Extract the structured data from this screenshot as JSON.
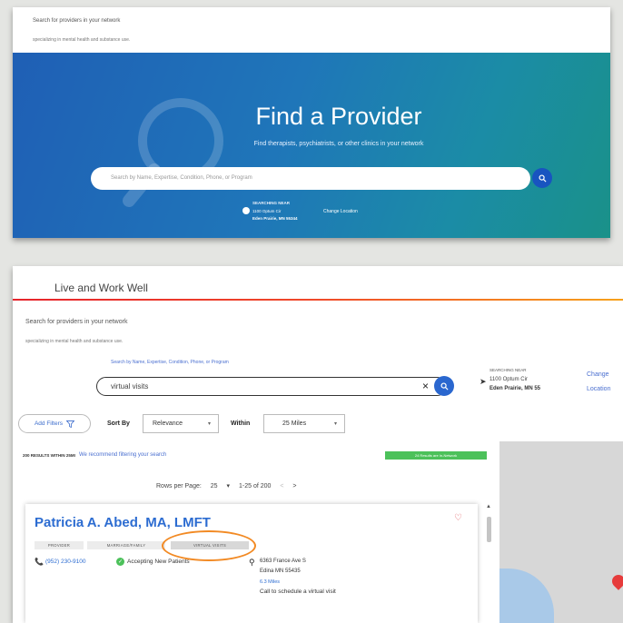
{
  "top": {
    "intro_line1": "Search for providers in your network",
    "intro_line2": "specializing in mental health and substance use.",
    "title": "Find a Provider",
    "subtitle": "Find therapists, psychiatrists, or other clinics in your network",
    "search_placeholder": "Search by Name, Expertise, Condition, Phone, or Program",
    "near_label": "SEARCHING NEAR",
    "address_line1": "1100 Optum Cir",
    "address_line2": "Eden Prairie, MN 55344",
    "change_location": "Change Location",
    "hero_colors": [
      "#1f5fb5",
      "#1a9189"
    ]
  },
  "bottom": {
    "brand": "Live and Work Well",
    "intro_line1": "Search for providers in your network",
    "intro_line2": "specializing in mental health and substance use.",
    "search_hint": "Search by Name, Expertise, Condition, Phone, or Program",
    "search_value": "virtual visits",
    "near_label": "SEARCHING NEAR",
    "address_line1": "1100 Optum Cir",
    "address_line2": "Eden Prairie, MN 55",
    "change_line1": "Change",
    "change_line2": "Location",
    "filters_label": "Add Filters",
    "sort_label": "Sort By",
    "sort_value": "Relevance",
    "within_label": "Within",
    "within_value": "25 Miles",
    "results_count": "200 RESULTS WITHIN 25MI",
    "results_recommend": "We recommend filtering your search",
    "green_badge": "24 Results are In-Network",
    "pager": {
      "rows_label": "Rows per Page:",
      "rows_value": "25",
      "range": "1-25 of 200",
      "prev": "<",
      "next": ">"
    },
    "provider": {
      "name": "Patricia A. Abed, MA, LMFT",
      "tags": [
        "PROVIDER",
        "MARRIAGE/FAMILY",
        "VIRTUAL VISITS"
      ],
      "phone": "(952) 230-9100",
      "accepting": "Accepting New Patients",
      "address_line1": "6363 France Ave S",
      "address_line2": "Edina MN 55435",
      "distance": "6.3 Miles",
      "call_note": "Call to schedule a virtual visit"
    },
    "accent_color": "#2c6cd1",
    "highlight_color": "#f28a24"
  }
}
